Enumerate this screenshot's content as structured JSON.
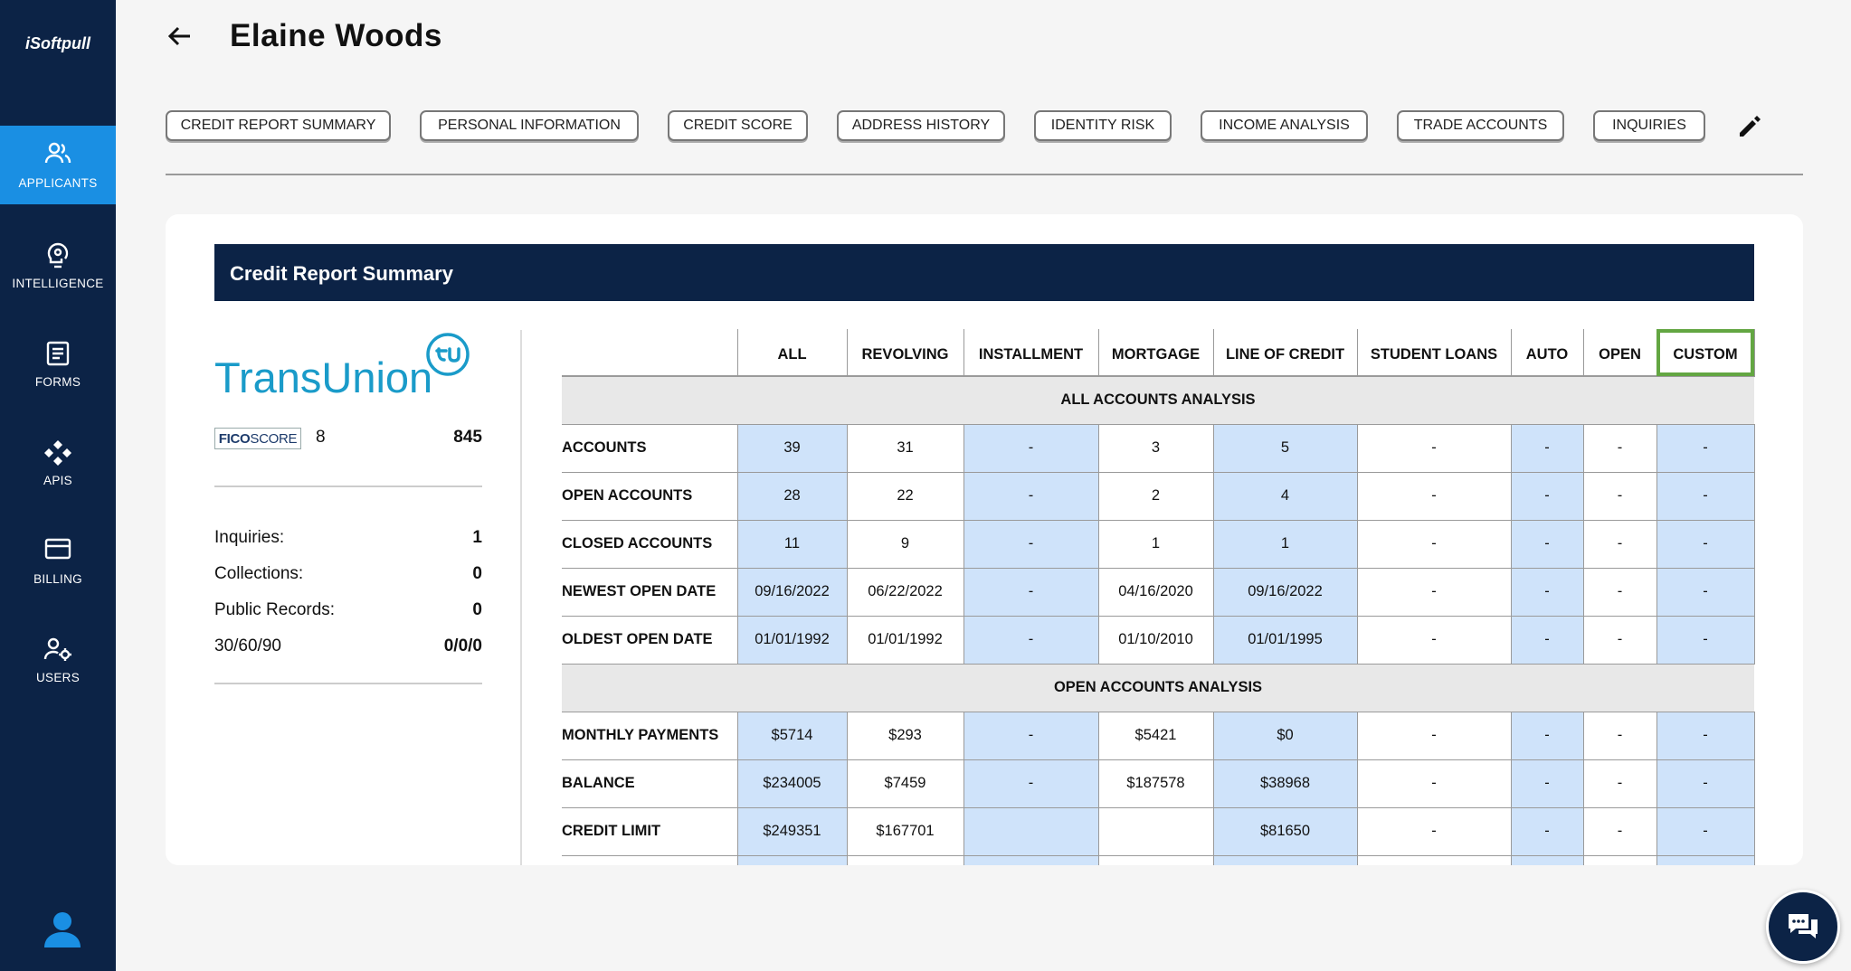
{
  "app": {
    "brand": "iSoftpull"
  },
  "sidebar": {
    "items": [
      {
        "label": "APPLICANTS",
        "icon": "users-icon",
        "active": true
      },
      {
        "label": "INTELLIGENCE",
        "icon": "brain-icon",
        "active": false
      },
      {
        "label": "FORMS",
        "icon": "document-icon",
        "active": false
      },
      {
        "label": "APIS",
        "icon": "api-icon",
        "active": false
      },
      {
        "label": "BILLING",
        "icon": "credit-card-icon",
        "active": false
      },
      {
        "label": "USERS",
        "icon": "user-gear-icon",
        "active": false
      }
    ]
  },
  "header": {
    "title": "Elaine Woods",
    "tabs": [
      "CREDIT REPORT SUMMARY",
      "PERSONAL INFORMATION",
      "CREDIT SCORE",
      "ADDRESS HISTORY",
      "IDENTITY RISK",
      "INCOME ANALYSIS",
      "TRADE ACCOUNTS",
      "INQUIRIES"
    ]
  },
  "card": {
    "title": "Credit Report Summary",
    "bureau": "TransUnion",
    "fico": {
      "badge_fico": "FICO",
      "badge_score": "SCORE",
      "version": "8",
      "score": "845"
    },
    "stats": [
      {
        "label": "Inquiries:",
        "value": "1"
      },
      {
        "label": "Collections:",
        "value": "0"
      },
      {
        "label": "Public Records:",
        "value": "0"
      },
      {
        "label": "30/60/90",
        "value": "0/0/0"
      }
    ],
    "table": {
      "columns": [
        "ALL",
        "REVOLVING",
        "INSTALLMENT",
        "MORTGAGE",
        "LINE OF CREDIT",
        "STUDENT LOANS",
        "AUTO",
        "OPEN",
        "CUSTOM"
      ],
      "sections": [
        {
          "title": "ALL ACCOUNTS ANALYSIS",
          "rows": [
            {
              "label": "ACCOUNTS",
              "cells": [
                "39",
                "31",
                "-",
                "3",
                "5",
                "-",
                "-",
                "-",
                "-"
              ]
            },
            {
              "label": "OPEN ACCOUNTS",
              "cells": [
                "28",
                "22",
                "-",
                "2",
                "4",
                "-",
                "-",
                "-",
                "-"
              ]
            },
            {
              "label": "CLOSED ACCOUNTS",
              "cells": [
                "11",
                "9",
                "-",
                "1",
                "1",
                "-",
                "-",
                "-",
                "-"
              ]
            },
            {
              "label": "NEWEST OPEN DATE",
              "cells": [
                "09/16/2022",
                "06/22/2022",
                "-",
                "04/16/2020",
                "09/16/2022",
                "-",
                "-",
                "-",
                "-"
              ]
            },
            {
              "label": "OLDEST OPEN DATE",
              "cells": [
                "01/01/1992",
                "01/01/1992",
                "-",
                "01/10/2010",
                "01/01/1995",
                "-",
                "-",
                "-",
                "-"
              ]
            }
          ]
        },
        {
          "title": "OPEN ACCOUNTS ANALYSIS",
          "rows": [
            {
              "label": "MONTHLY PAYMENTS",
              "cells": [
                "$5714",
                "$293",
                "-",
                "$5421",
                "$0",
                "-",
                "-",
                "-",
                "-"
              ]
            },
            {
              "label": "BALANCE",
              "cells": [
                "$234005",
                "$7459",
                "-",
                "$187578",
                "$38968",
                "-",
                "-",
                "-",
                "-"
              ]
            },
            {
              "label": "CREDIT LIMIT",
              "cells": [
                "$249351",
                "$167701",
                "",
                "",
                "$81650",
                "-",
                "-",
                "-",
                "-"
              ]
            },
            {
              "label": "",
              "cells": [
                "",
                "",
                "",
                "",
                "",
                "",
                "",
                "",
                ""
              ]
            }
          ]
        }
      ]
    }
  },
  "colors": {
    "navy": "#0c2346",
    "accent": "#1a8fe3",
    "cell_blue": "#cfe3fa",
    "highlight": "#63a642",
    "transunion": "#1a9bc9"
  }
}
